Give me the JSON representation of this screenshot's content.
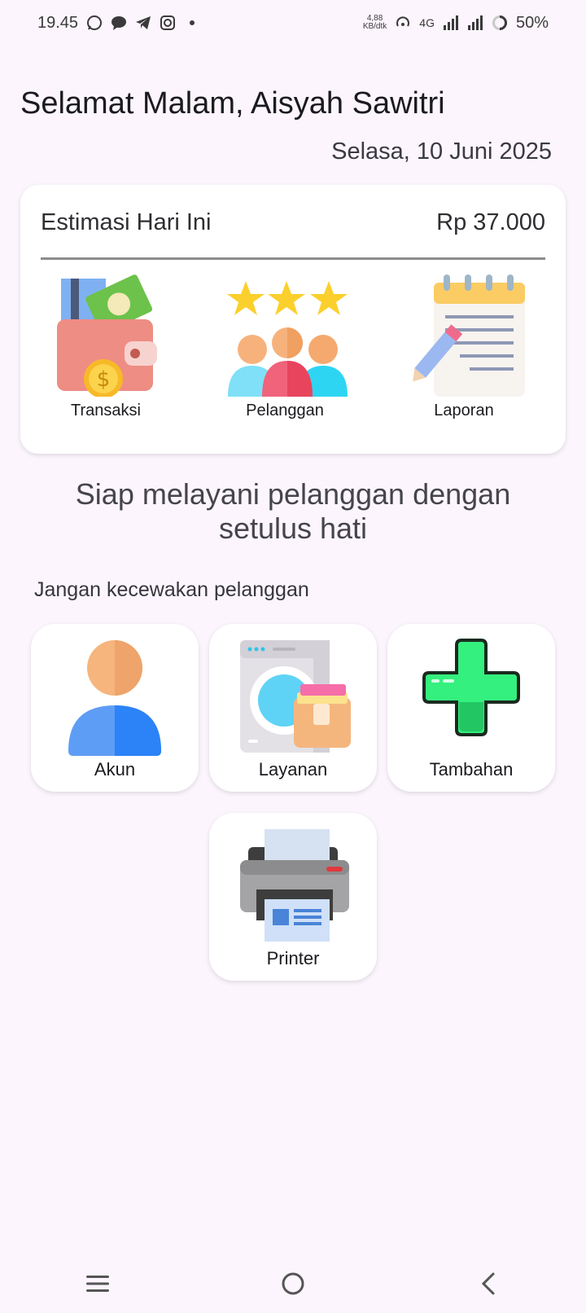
{
  "status_bar": {
    "time": "19.45",
    "net_speed_value": "4,88",
    "net_speed_unit": "KB/dtk",
    "network": "4G",
    "battery": "50%",
    "icons": [
      "whatsapp-icon",
      "chat-icon",
      "telegram-icon",
      "instagram-icon",
      "dot-icon",
      "hotspot-icon",
      "signal-icon",
      "battery-icon"
    ]
  },
  "header": {
    "greeting": "Selamat Malam, Aisyah Sawitri",
    "date": "Selasa, 10 Juni 2025"
  },
  "summary": {
    "label": "Estimasi Hari Ini",
    "amount": "Rp 37.000",
    "menu": [
      {
        "label": "Transaksi",
        "icon": "wallet-icon"
      },
      {
        "label": "Pelanggan",
        "icon": "customers-icon"
      },
      {
        "label": "Laporan",
        "icon": "notepad-icon"
      }
    ]
  },
  "tagline": {
    "line1": "Siap melayani pelanggan dengan",
    "line2": "setulus hati"
  },
  "subhead": "Jangan kecewakan pelanggan",
  "tiles": [
    {
      "label": "Akun",
      "icon": "user-icon"
    },
    {
      "label": "Layanan",
      "icon": "washing-machine-icon"
    },
    {
      "label": "Tambahan",
      "icon": "plus-icon"
    },
    {
      "label": "Printer",
      "icon": "printer-icon"
    }
  ],
  "nav": {
    "icons": [
      "menu-icon",
      "home-icon",
      "back-icon"
    ]
  },
  "colors": {
    "background": "#fcf5fd",
    "card": "#ffffff",
    "plus_green": "#35f07f",
    "user_blue": "#3a8efc"
  }
}
